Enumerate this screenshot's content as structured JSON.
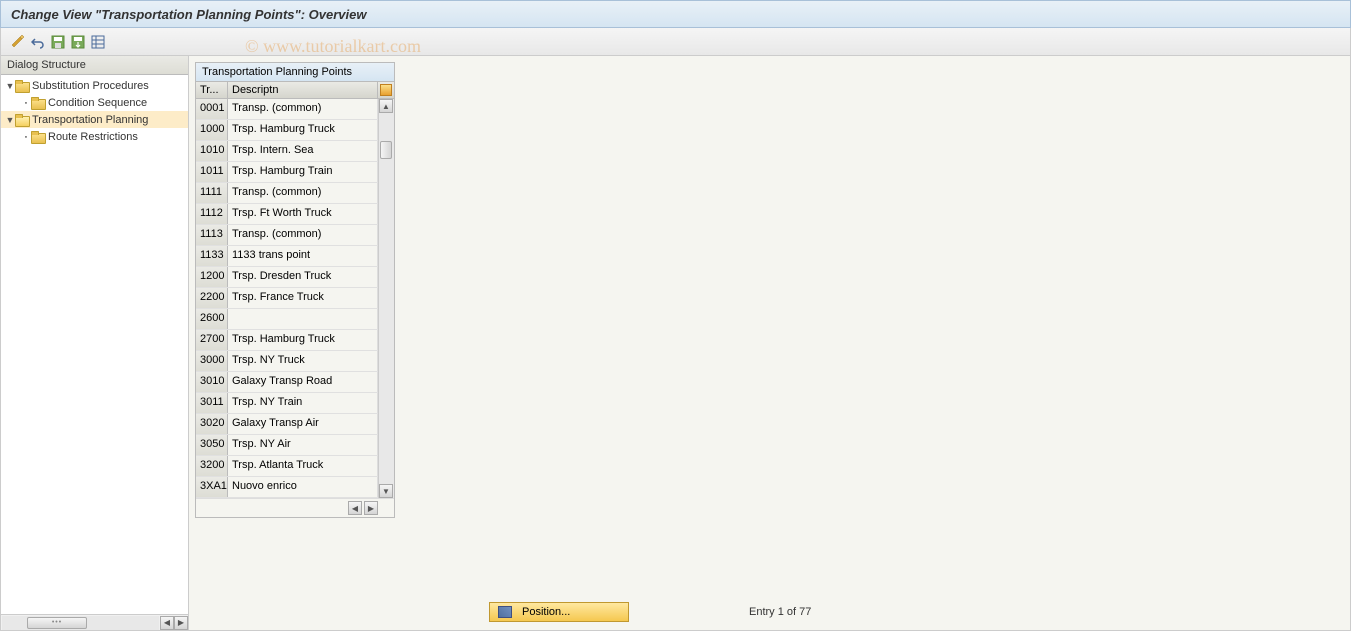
{
  "title": "Change View \"Transportation Planning Points\": Overview",
  "watermark": "© www.tutorialkart.com",
  "sidebar": {
    "header": "Dialog Structure",
    "items": [
      {
        "label": "Substitution Procedures",
        "level": 0,
        "expander": "▼",
        "open": false,
        "selected": false
      },
      {
        "label": "Condition Sequence",
        "level": 1,
        "expander": "•",
        "open": false,
        "selected": false
      },
      {
        "label": "Transportation Planning",
        "level": 0,
        "expander": "▼",
        "open": true,
        "selected": true
      },
      {
        "label": "Route Restrictions",
        "level": 1,
        "expander": "•",
        "open": false,
        "selected": false
      }
    ]
  },
  "table": {
    "title": "Transportation Planning Points",
    "col_code": "Tr...",
    "col_desc": "Descriptn",
    "rows": [
      {
        "code": "0001",
        "desc": "Transp. (common)"
      },
      {
        "code": "1000",
        "desc": "Trsp. Hamburg Truck"
      },
      {
        "code": "1010",
        "desc": "Trsp. Intern. Sea"
      },
      {
        "code": "1011",
        "desc": "Trsp. Hamburg Train"
      },
      {
        "code": "1111",
        "desc": "Transp. (common)"
      },
      {
        "code": "1112",
        "desc": "Trsp. Ft Worth Truck"
      },
      {
        "code": "1113",
        "desc": "Transp. (common)"
      },
      {
        "code": "1133",
        "desc": "1133 trans point"
      },
      {
        "code": "1200",
        "desc": "Trsp. Dresden Truck"
      },
      {
        "code": "2200",
        "desc": "Trsp. France Truck"
      },
      {
        "code": "2600",
        "desc": ""
      },
      {
        "code": "2700",
        "desc": "Trsp. Hamburg Truck"
      },
      {
        "code": "3000",
        "desc": "Trsp. NY Truck"
      },
      {
        "code": "3010",
        "desc": "Galaxy Transp Road"
      },
      {
        "code": "3011",
        "desc": "Trsp. NY Train"
      },
      {
        "code": "3020",
        "desc": "Galaxy Transp Air"
      },
      {
        "code": "3050",
        "desc": "Trsp. NY Air"
      },
      {
        "code": "3200",
        "desc": "Trsp. Atlanta Truck"
      },
      {
        "code": "3XA1",
        "desc": "Nuovo enrico"
      }
    ]
  },
  "footer": {
    "position_label": "Position...",
    "entry_text": "Entry 1 of 77"
  }
}
